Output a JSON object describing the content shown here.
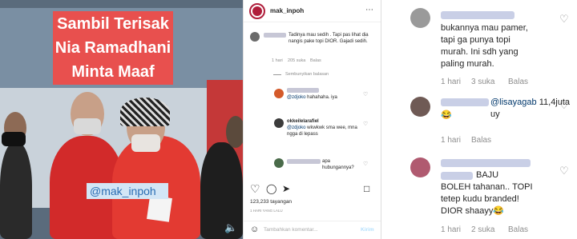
{
  "video": {
    "title_lines": [
      "Sambil Terisak",
      "Nia Ramadhani",
      "Minta Maaf"
    ],
    "watermark": "@mak_inpoh",
    "speaker_icon": "speaker-icon"
  },
  "post": {
    "username": "mak_inpoh",
    "more_icon": "more-dots-icon",
    "comments": [
      {
        "text": "Tadinya mau sedih . Tapi pas lihat dia nangis pake topi DIOR. Gajadi sedih.",
        "time": "1 hari",
        "likes": "205 suka",
        "reply": "Balas"
      }
    ],
    "hide_replies": "Sembunyikan balasan",
    "replies": [
      {
        "mention": "@zdjoko",
        "text": "hahahaha. iya"
      },
      {
        "user": "okkeilelarafiel",
        "mention": "@zdjoko",
        "text": "wkwkwk sma wee, mna ngga di lepass"
      },
      {
        "text": "apa hubungannya?"
      }
    ],
    "likes": "123,233 tayangan",
    "time": "1 HARI YANG LALU",
    "add_comment_placeholder": "Tambahkan komentar...",
    "send_label": "Kirim"
  },
  "right": {
    "comments": [
      {
        "text_lines": [
          "bukannya mau pamer,",
          "tapi ga punya topi",
          "murah. Ini sdh yang",
          "paling murah."
        ],
        "time": "1 hari",
        "likes": "3 suka",
        "reply": "Balas"
      },
      {
        "mention": "@lisayagab",
        "text": "11,4juta uy",
        "emoji": "😂",
        "time": "1 hari",
        "reply": "Balas"
      },
      {
        "text_lines": [
          "BAJU",
          "BOLEH tahanan.. TOPI",
          "tetep kudu branded!",
          "DIOR shaayy"
        ],
        "emoji": "😂",
        "time": "1 hari",
        "likes": "2 suka",
        "reply": "Balas"
      }
    ]
  }
}
